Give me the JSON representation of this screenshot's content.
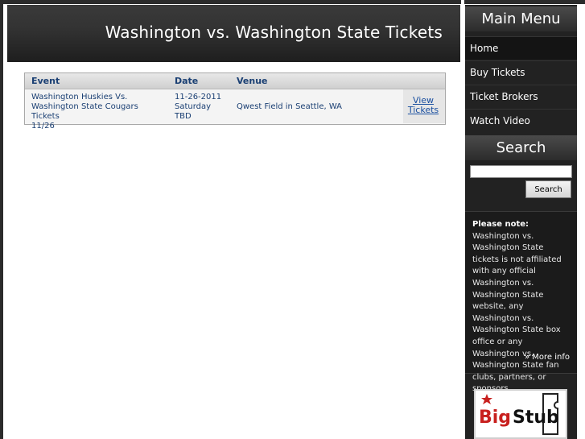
{
  "header": {
    "title": "Washington vs. Washington State Tickets"
  },
  "table": {
    "columns": [
      "Event",
      "Date",
      "Venue"
    ],
    "rows": [
      {
        "event_line1": "Washington Huskies Vs.",
        "event_line2": "Washington State Cougars Tickets",
        "event_line3": "11/26",
        "date_line1": "11-26-2011",
        "date_line2": "Saturday",
        "date_line3": "TBD",
        "venue": "Qwest Field in Seattle, WA",
        "action_line1": "View",
        "action_line2": "Tickets"
      }
    ]
  },
  "sidebar": {
    "menu_title": "Main Menu",
    "menu_items": [
      "Home",
      "Buy Tickets",
      "Ticket Brokers",
      "Watch Video"
    ],
    "search_title": "Search",
    "search_button": "Search",
    "search_value": "",
    "note_label": "Please note:",
    "note_text": " Washington vs. Washington State tickets is not affiliated with any official Washington vs. Washington State website, any Washington vs. Washington State box office or any Washington vs. Washington State fan clubs, partners, or sponsors.",
    "more_info": "» More info",
    "logo_text": "BigStub"
  },
  "colors": {
    "link": "#1a3f73",
    "sidebar_bg": "#222222",
    "logo_red": "#c8201e"
  }
}
